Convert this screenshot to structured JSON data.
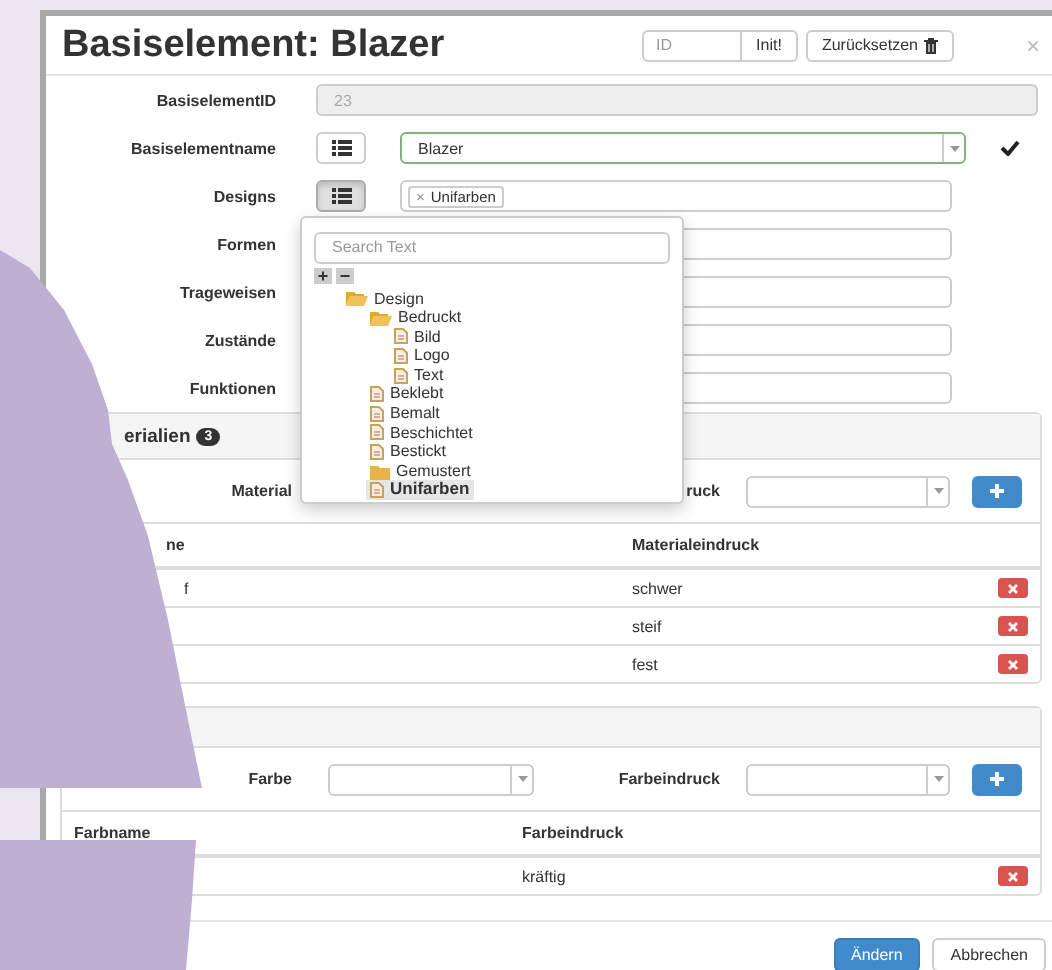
{
  "dialog": {
    "title": "Basiselement: Blazer",
    "id_field": {
      "placeholder": "ID"
    },
    "init_button": "Init!",
    "reset_button": "Zurücksetzen",
    "close": "×"
  },
  "form": [
    {
      "kind": "readonly",
      "label": "BasiselementID",
      "value": "23"
    },
    {
      "kind": "select",
      "label": "Basiselementname",
      "value": "Blazer",
      "valid": true,
      "picker_pressed": false
    },
    {
      "kind": "tags",
      "label": "Designs",
      "tags": [
        {
          "remove": "×",
          "text": "Unifarben"
        }
      ],
      "picker_pressed": true
    },
    {
      "kind": "text",
      "label": "Formen"
    },
    {
      "kind": "text",
      "label": "Trageweisen"
    },
    {
      "kind": "text",
      "label": "Zustände"
    },
    {
      "kind": "text",
      "label": "Funktionen"
    }
  ],
  "design_dropdown": {
    "search": {
      "placeholder": "Search Text"
    },
    "expand_all": "+",
    "collapse_all": "−",
    "tree": [
      {
        "kind": "folder",
        "label": "Design",
        "expanded": true,
        "selected": false,
        "children": [
          {
            "kind": "folder",
            "label": "Bedruckt",
            "expanded": true,
            "selected": false,
            "children": [
              {
                "kind": "file",
                "label": "Bild",
                "selected": false
              },
              {
                "kind": "file",
                "label": "Logo",
                "selected": false
              },
              {
                "kind": "file",
                "label": "Text",
                "selected": false
              }
            ]
          },
          {
            "kind": "file",
            "label": "Beklebt",
            "selected": false
          },
          {
            "kind": "file",
            "label": "Bemalt",
            "selected": false
          },
          {
            "kind": "file",
            "label": "Beschichtet",
            "selected": false
          },
          {
            "kind": "file",
            "label": "Bestickt",
            "selected": false
          },
          {
            "kind": "folder",
            "label": "Gemustert",
            "expanded": false,
            "selected": false
          },
          {
            "kind": "file",
            "label": "Unifarben",
            "selected": true
          }
        ]
      }
    ]
  },
  "panels": [
    {
      "header": "erialien",
      "count": "3",
      "fields": [
        {
          "label": "Material",
          "select": false
        },
        {
          "label": "ruck",
          "select": true
        }
      ],
      "columns": [
        "ne",
        "Materialeindruck"
      ],
      "rows": [
        {
          "name": "f",
          "impression": "schwer"
        },
        {
          "impression": "steif"
        },
        {
          "impression": "fest"
        }
      ]
    },
    {
      "fields": [
        {
          "label": "Farbe",
          "select": true
        },
        {
          "label": "Farbeindruck",
          "select": true
        }
      ],
      "columns": [
        "Farbname",
        "Farbeindruck"
      ],
      "rows": [
        {
          "impression": "kräftig"
        }
      ]
    }
  ],
  "footer": {
    "save": "Ändern",
    "cancel": "Abbrechen"
  }
}
